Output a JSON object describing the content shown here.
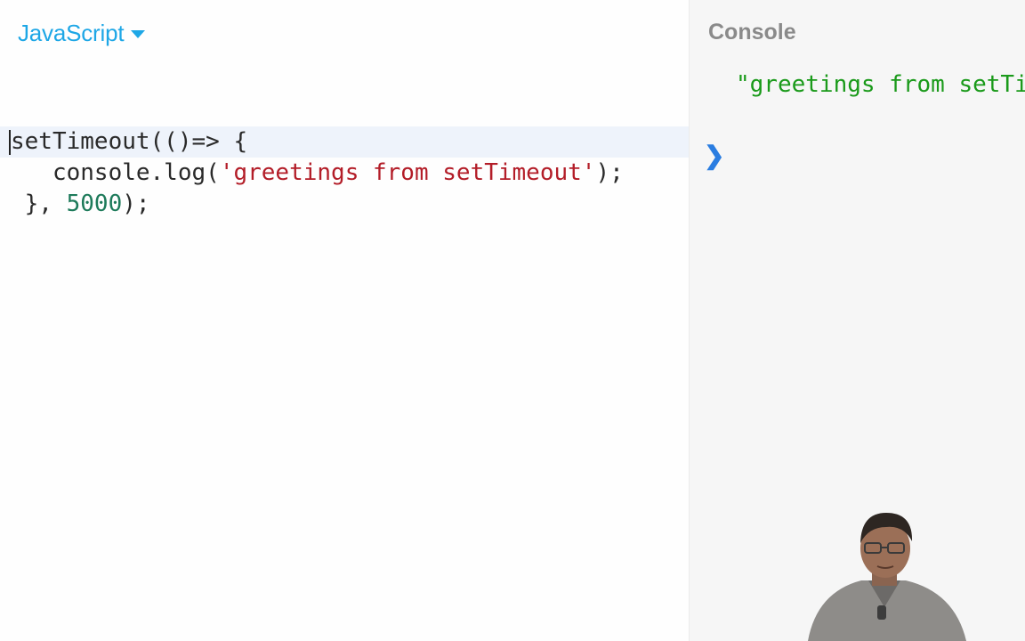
{
  "editor": {
    "language": "JavaScript",
    "code_lines": [
      {
        "tokens": [
          {
            "t": "setTimeout(()=> {",
            "c": "plain"
          }
        ]
      },
      {
        "tokens": [
          {
            "t": "   console.log(",
            "c": "plain"
          },
          {
            "t": "'greetings from setTimeout'",
            "c": "str"
          },
          {
            "t": ");",
            "c": "plain"
          }
        ]
      },
      {
        "tokens": [
          {
            "t": " }, ",
            "c": "plain"
          },
          {
            "t": "5000",
            "c": "num"
          },
          {
            "t": ");",
            "c": "plain"
          }
        ]
      }
    ]
  },
  "console": {
    "title": "Console",
    "output": "\"greetings from setTimeout\"",
    "prompt_icon": "chevron-right-icon"
  },
  "colors": {
    "accent": "#1ea7e6",
    "string": "#b31d28",
    "number": "#1d7a5a",
    "console_output": "#1a9a1a",
    "prompt": "#2a7de1"
  }
}
